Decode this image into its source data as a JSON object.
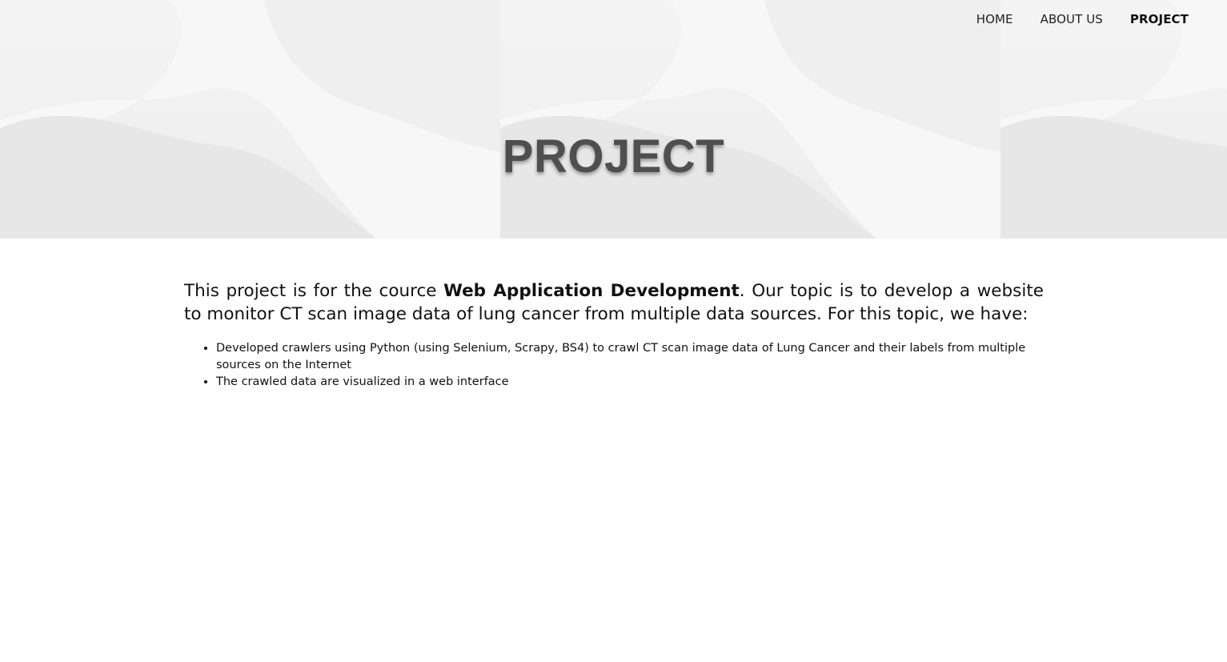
{
  "nav": {
    "items": [
      {
        "label": "HOME",
        "active": false
      },
      {
        "label": "ABOUT US",
        "active": false
      },
      {
        "label": "PROJECT",
        "active": true
      }
    ]
  },
  "hero": {
    "title": "PROJECT"
  },
  "content": {
    "intro_prefix": "This project is for the cource ",
    "intro_course": "Web Application Development",
    "intro_suffix": ". Our topic is to develop a website to monitor CT scan image data of lung cancer from multiple data sources. For this topic, we have:",
    "bullets": [
      "Developed crawlers using Python (using Selenium, Scrapy, BS4) to crawl CT scan image data of Lung Cancer and their labels from multiple sources on the Internet",
      "The crawled data are visualized in a web interface"
    ]
  },
  "colors": {
    "hero_bg": "#efefef",
    "title": "#4f4f4f",
    "text": "#111111"
  }
}
